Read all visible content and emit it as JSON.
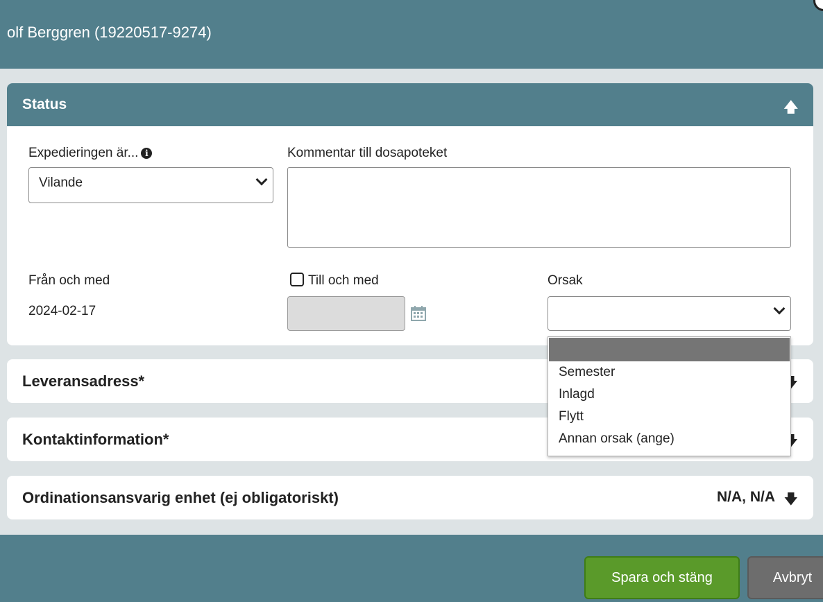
{
  "header": {
    "title": "olf Berggren (19220517-9274)"
  },
  "status_panel": {
    "title": "Status",
    "expediering_label": "Expedieringen är...",
    "expediering_value": "Vilande",
    "kommentar_label": "Kommentar till dosapoteket",
    "kommentar_value": "",
    "fran_label": "Från och med",
    "fran_value": "2024-02-17",
    "till_label": "Till och med",
    "till_checked": false,
    "till_value": "",
    "orsak_label": "Orsak",
    "orsak_value": ""
  },
  "orsak_dropdown": {
    "options": [
      "",
      "Semester",
      "Inlagd",
      "Flytt",
      "Annan orsak (ange)"
    ],
    "highlighted_index": 0
  },
  "sections": [
    {
      "title": "Leveransadress*",
      "value": ""
    },
    {
      "title": "Kontaktinformation*",
      "value": ""
    },
    {
      "title": "Ordinationsansvarig enhet (ej obligatoriskt)",
      "value": "N/A, N/A"
    }
  ],
  "footer": {
    "save_label": "Spara och stäng",
    "cancel_label": "Avbryt"
  },
  "colors": {
    "header_bg": "#527f8c",
    "body_bg": "#dde3e5",
    "save_button": "#5a9a2a",
    "cancel_button": "#6d6d6d"
  },
  "icons": {
    "collapse": "arrow-up-icon",
    "expand": "arrow-down-icon",
    "info": "info-icon",
    "calendar": "calendar-icon"
  }
}
